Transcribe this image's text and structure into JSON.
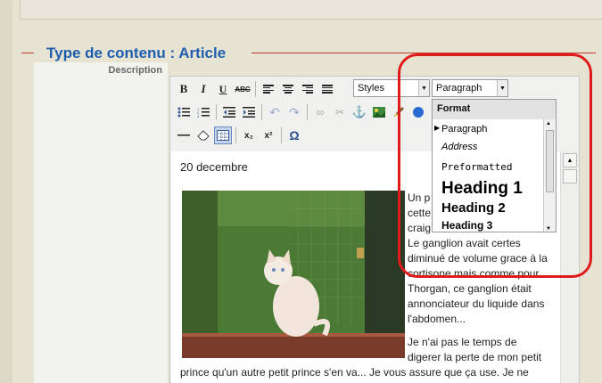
{
  "section": {
    "legend": "Type de contenu : Article",
    "description_label": "Description"
  },
  "toolbar": {
    "row1": {
      "bold": "B",
      "italic": "I",
      "underline": "U",
      "strike": "ABC",
      "styles_value": "Styles",
      "format_value": "Paragraph"
    },
    "row2_icons": [
      "bullet-list-icon",
      "numbered-list-icon",
      "outdent-icon",
      "indent-icon",
      "undo-icon",
      "redo-icon",
      "link-icon",
      "unlink-icon",
      "anchor-icon",
      "image-icon",
      "cleanup-icon",
      "help-icon"
    ],
    "row3": {
      "subscript": "x₂",
      "superscript": "x²",
      "omega": "Ω"
    }
  },
  "format_menu": {
    "title": "Format",
    "items": [
      {
        "label": "Paragraph",
        "selected": true
      },
      {
        "label": "Address"
      },
      {
        "label": "Preformatted"
      },
      {
        "label": "Heading 1"
      },
      {
        "label": "Heading 2"
      },
      {
        "label": "Heading 3"
      }
    ]
  },
  "content": {
    "date": "20 decembre",
    "text_lines": [
      "Un p",
      "cette",
      "craig",
      "Le ganglion avait certes",
      "diminué de volume grace à la",
      "cortisone mais comme pour",
      "Thorgan, ce ganglion était",
      "annonciateur du liquide dans",
      "l'abdomen..."
    ],
    "para2_line1": "Je n'ai pas le temps de",
    "para2_line2": "digerer la perte de mon petit",
    "para2_line3": "prince qu'un autre petit prince s'en va... Je vous assure que ça use. Je ne"
  },
  "colors": {
    "legend": "#1f5fae",
    "highlight_ring": "#e01b1b",
    "legend_rule": "#c0392b"
  }
}
